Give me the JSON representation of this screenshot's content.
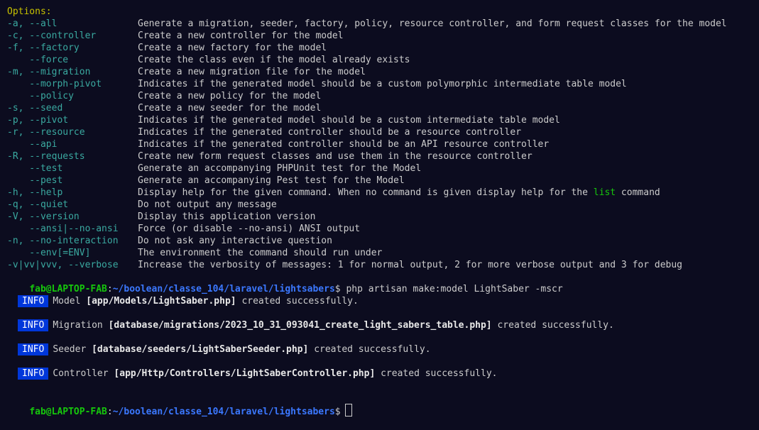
{
  "options_header": "Options:",
  "options": [
    {
      "flag": "-a, --all",
      "desc": "Generate a migration, seeder, factory, policy, resource controller, and form request classes for the model"
    },
    {
      "flag": "-c, --controller",
      "desc": "Create a new controller for the model"
    },
    {
      "flag": "-f, --factory",
      "desc": "Create a new factory for the model"
    },
    {
      "flag": "    --force",
      "desc": "Create the class even if the model already exists"
    },
    {
      "flag": "-m, --migration",
      "desc": "Create a new migration file for the model"
    },
    {
      "flag": "    --morph-pivot",
      "desc": "Indicates if the generated model should be a custom polymorphic intermediate table model"
    },
    {
      "flag": "    --policy",
      "desc": "Create a new policy for the model"
    },
    {
      "flag": "-s, --seed",
      "desc": "Create a new seeder for the model"
    },
    {
      "flag": "-p, --pivot",
      "desc": "Indicates if the generated model should be a custom intermediate table model"
    },
    {
      "flag": "-r, --resource",
      "desc": "Indicates if the generated controller should be a resource controller"
    },
    {
      "flag": "    --api",
      "desc": "Indicates if the generated controller should be an API resource controller"
    },
    {
      "flag": "-R, --requests",
      "desc": "Create new form request classes and use them in the resource controller"
    },
    {
      "flag": "    --test",
      "desc": "Generate an accompanying PHPUnit test for the Model"
    },
    {
      "flag": "    --pest",
      "desc": "Generate an accompanying Pest test for the Model"
    },
    {
      "flag": "-h, --help",
      "desc_pre": "Display help for the given command. When no command is given display help for the ",
      "desc_hl": "list",
      "desc_post": " command"
    },
    {
      "flag": "-q, --quiet",
      "desc": "Do not output any message"
    },
    {
      "flag": "-V, --version",
      "desc": "Display this application version"
    },
    {
      "flag": "    --ansi|--no-ansi",
      "desc": "Force (or disable --no-ansi) ANSI output"
    },
    {
      "flag": "-n, --no-interaction",
      "desc": "Do not ask any interactive question"
    },
    {
      "flag": "    --env[=ENV]",
      "desc": "The environment the command should run under"
    },
    {
      "flag": "-v|vv|vvv, --verbose",
      "desc": "Increase the verbosity of messages: 1 for normal output, 2 for more verbose output and 3 for debug"
    }
  ],
  "prompt": {
    "user": "fab@LAPTOP-FAB",
    "sep": ":",
    "path": "~/boolean/classe_104/laravel/lightsabers",
    "dollar": "$",
    "command": "php artisan make:model LightSaber -mscr"
  },
  "info_messages": [
    {
      "badge": "INFO",
      "kind": "Model",
      "path": "[app/Models/LightSaber.php]",
      "status": "created successfully."
    },
    {
      "badge": "INFO",
      "kind": "Migration",
      "path": "[database/migrations/2023_10_31_093041_create_light_sabers_table.php]",
      "status": "created successfully."
    },
    {
      "badge": "INFO",
      "kind": "Seeder",
      "path": "[database/seeders/LightSaberSeeder.php]",
      "status": "created successfully."
    },
    {
      "badge": "INFO",
      "kind": "Controller",
      "path": "[app/Http/Controllers/LightSaberController.php]",
      "status": "created successfully."
    }
  ],
  "final_prompt": {
    "user": "fab@LAPTOP-FAB",
    "sep": ":",
    "path": "~/boolean/classe_104/laravel/lightsabers",
    "dollar": "$"
  },
  "colors": {
    "background": "#0c0c1f",
    "header": "#c8c200",
    "flag": "#3aa9a0",
    "prompt_user": "#16c60c",
    "prompt_path": "#3b78ff",
    "info_badge": "#0037da"
  }
}
